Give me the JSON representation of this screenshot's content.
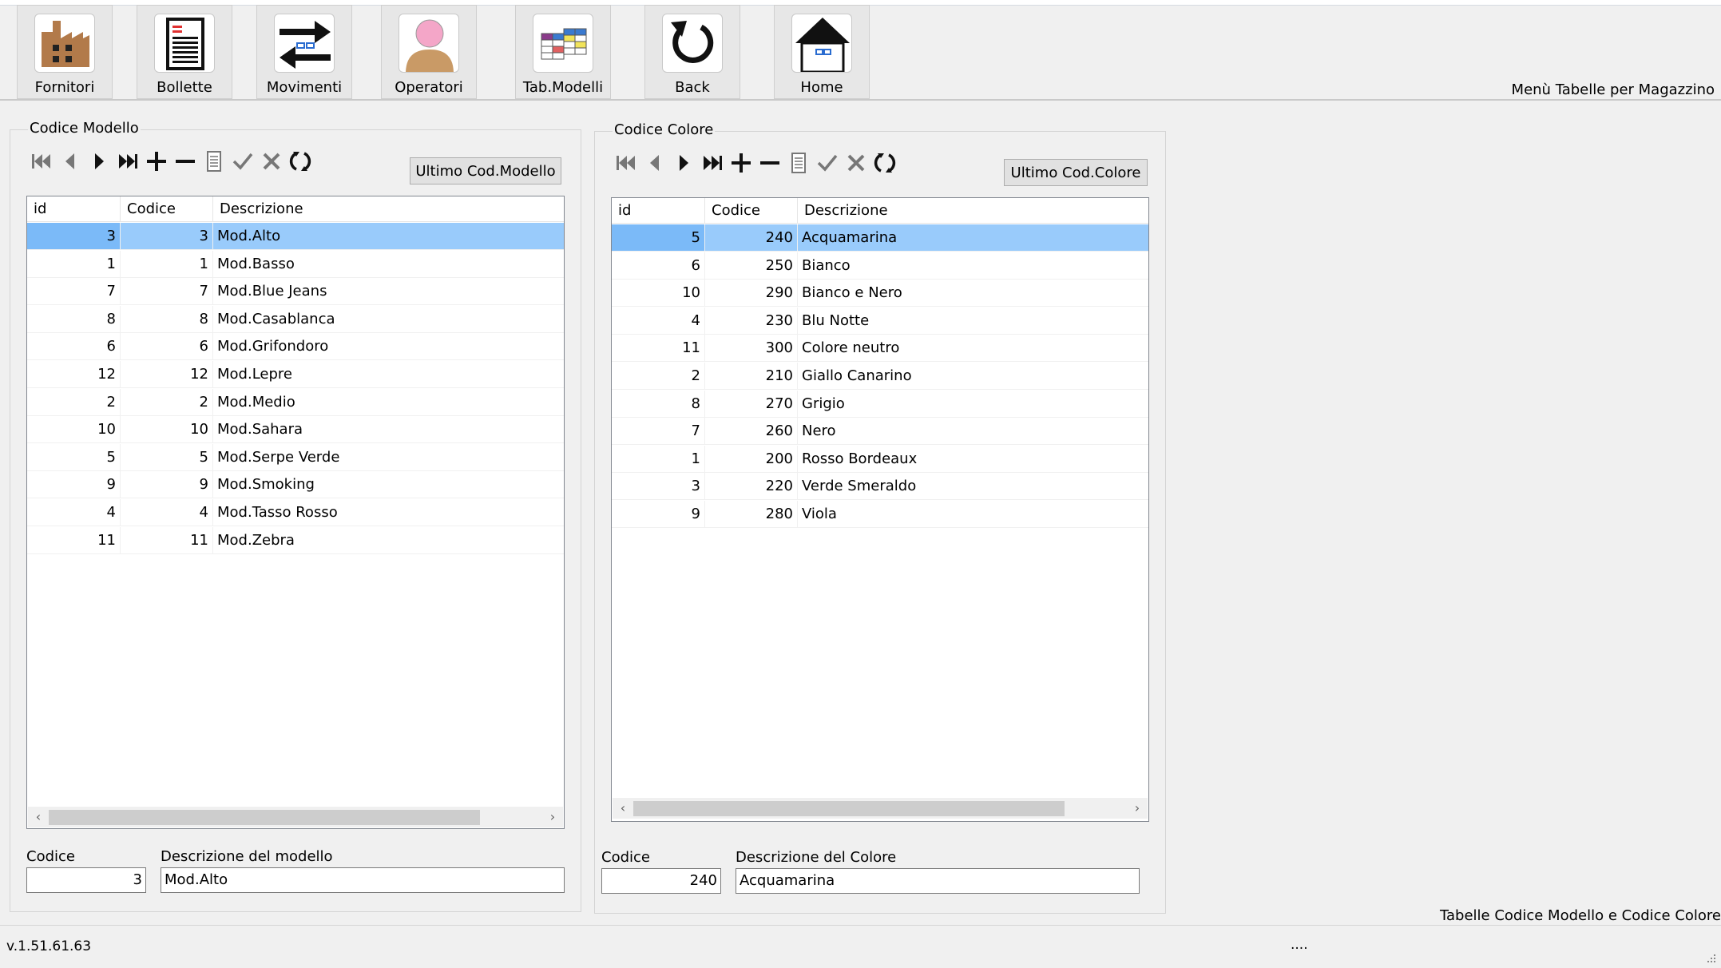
{
  "toolbar": {
    "buttons": [
      {
        "label": "Fornitori",
        "icon": "factory-icon"
      },
      {
        "label": "Bollette",
        "icon": "document-icon"
      },
      {
        "label": "Movimenti",
        "icon": "transfer-arrows-icon"
      },
      {
        "label": "Operatori",
        "icon": "user-icon"
      },
      {
        "label": "Tab.Modelli",
        "icon": "table-icon"
      },
      {
        "label": "Back",
        "icon": "back-arrow-icon"
      },
      {
        "label": "Home",
        "icon": "home-icon"
      }
    ],
    "menu_title": "Menù Tabelle per Magazzino"
  },
  "modello": {
    "group_title": "Codice Modello",
    "last_button": "Ultimo Cod.Modello",
    "columns": [
      "id",
      "Codice",
      "Descrizione"
    ],
    "rows": [
      {
        "id": "3",
        "codice": "3",
        "descrizione": "Mod.Alto"
      },
      {
        "id": "1",
        "codice": "1",
        "descrizione": "Mod.Basso"
      },
      {
        "id": "7",
        "codice": "7",
        "descrizione": "Mod.Blue Jeans"
      },
      {
        "id": "8",
        "codice": "8",
        "descrizione": "Mod.Casablanca"
      },
      {
        "id": "6",
        "codice": "6",
        "descrizione": "Mod.Grifondoro"
      },
      {
        "id": "12",
        "codice": "12",
        "descrizione": "Mod.Lepre"
      },
      {
        "id": "2",
        "codice": "2",
        "descrizione": "Mod.Medio"
      },
      {
        "id": "10",
        "codice": "10",
        "descrizione": "Mod.Sahara"
      },
      {
        "id": "5",
        "codice": "5",
        "descrizione": "Mod.Serpe Verde"
      },
      {
        "id": "9",
        "codice": "9",
        "descrizione": "Mod.Smoking"
      },
      {
        "id": "4",
        "codice": "4",
        "descrizione": "Mod.Tasso Rosso"
      },
      {
        "id": "11",
        "codice": "11",
        "descrizione": "Mod.Zebra"
      }
    ],
    "selected_index": 0,
    "codice_label": "Codice",
    "codice_value": "3",
    "descr_label": "Descrizione del modello",
    "descr_value": "Mod.Alto"
  },
  "colore": {
    "group_title": "Codice Colore",
    "last_button": "Ultimo Cod.Colore",
    "columns": [
      "id",
      "Codice",
      "Descrizione"
    ],
    "rows": [
      {
        "id": "5",
        "codice": "240",
        "descrizione": "Acquamarina"
      },
      {
        "id": "6",
        "codice": "250",
        "descrizione": "Bianco"
      },
      {
        "id": "10",
        "codice": "290",
        "descrizione": "Bianco e Nero"
      },
      {
        "id": "4",
        "codice": "230",
        "descrizione": "Blu Notte"
      },
      {
        "id": "11",
        "codice": "300",
        "descrizione": "Colore neutro"
      },
      {
        "id": "2",
        "codice": "210",
        "descrizione": "Giallo Canarino"
      },
      {
        "id": "8",
        "codice": "270",
        "descrizione": "Grigio"
      },
      {
        "id": "7",
        "codice": "260",
        "descrizione": "Nero"
      },
      {
        "id": "1",
        "codice": "200",
        "descrizione": "Rosso Bordeaux"
      },
      {
        "id": "3",
        "codice": "220",
        "descrizione": "Verde Smeraldo"
      },
      {
        "id": "9",
        "codice": "280",
        "descrizione": "Viola"
      }
    ],
    "selected_index": 0,
    "codice_label": "Codice",
    "codice_value": "240",
    "descr_label": "Descrizione del Colore",
    "descr_value": "Acquamarina"
  },
  "footer": {
    "label": "Tabelle Codice Modello e Codice Colore",
    "version": "v.1.51.61.63",
    "status": "...."
  },
  "colors": {
    "selection": "#99cbfb",
    "selection_id": "#7bbaf8",
    "background": "#f0f0f0"
  }
}
